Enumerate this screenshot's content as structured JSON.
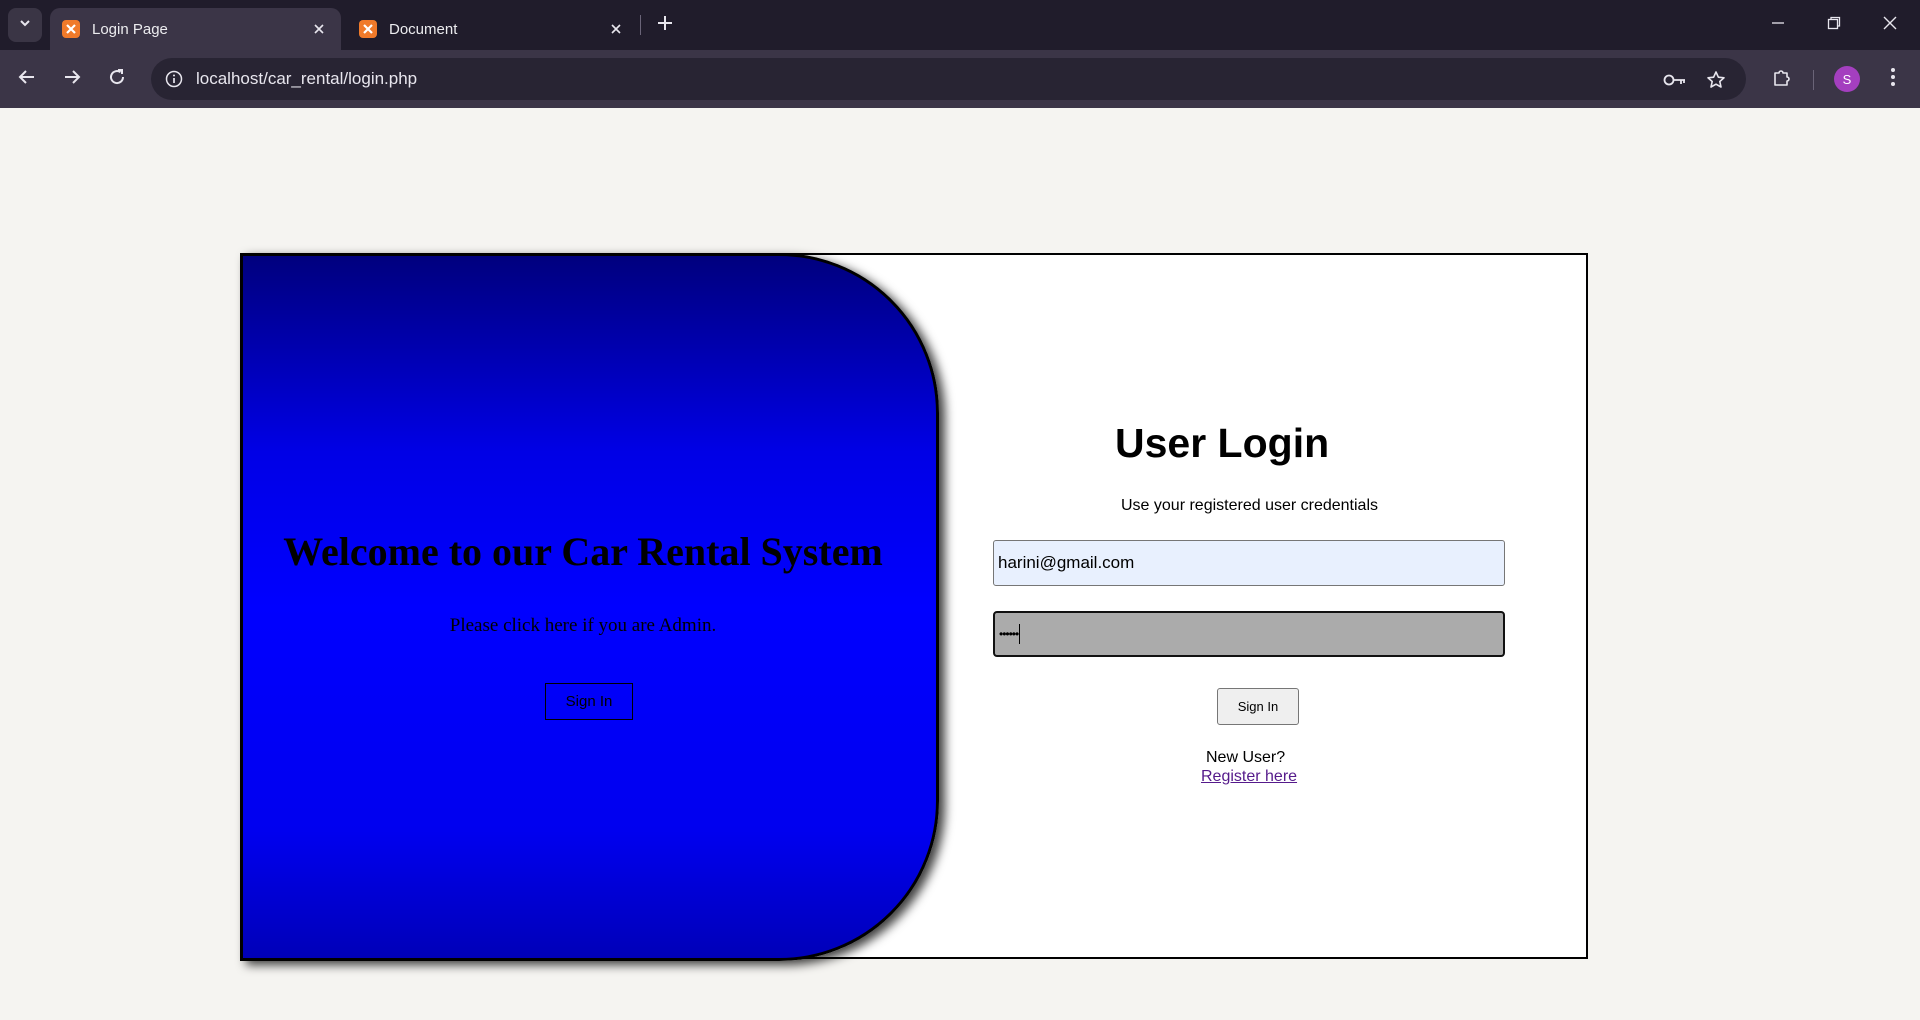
{
  "browser": {
    "tabs": [
      {
        "title": "Login Page",
        "active": true
      },
      {
        "title": "Document",
        "active": false
      }
    ],
    "url": "localhost/car_rental/login.php",
    "profile_initial": "S"
  },
  "admin_panel": {
    "heading": "Welcome to our Car Rental System",
    "text": "Please click here if you are Admin.",
    "button_label": "Sign In"
  },
  "login": {
    "title": "User Login",
    "subtitle": "Use your registered user credentials",
    "email_value": "harini@gmail.com",
    "password_mask": "••••••",
    "button_label": "Sign In",
    "new_user_text": "New User?",
    "register_link": "Register here"
  },
  "colors": {
    "panel_blue": "#0000ff",
    "autofill_bg": "#e8f0fe",
    "link": "#551a8b"
  }
}
